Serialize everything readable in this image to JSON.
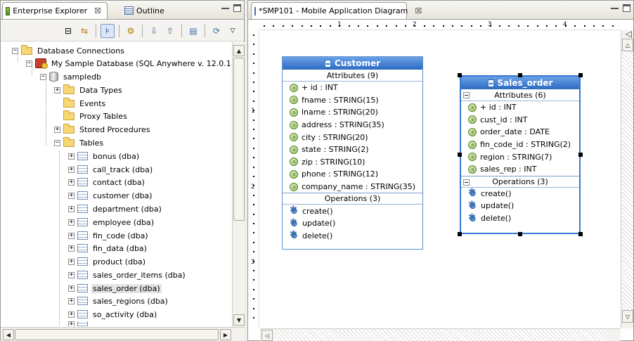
{
  "explorer": {
    "tabs": [
      {
        "label": "Enterprise Explorer",
        "close": "☒"
      },
      {
        "label": "Outline"
      }
    ],
    "tree": {
      "root": "Database Connections",
      "connection": "My Sample Database (SQL Anywhere v. 12.0.1",
      "database": "sampledb",
      "folders": [
        "Data Types",
        "Events",
        "Proxy Tables",
        "Stored Procedures",
        "Tables"
      ],
      "tables": [
        "bonus (dba)",
        "call_track (dba)",
        "contact (dba)",
        "customer (dba)",
        "department (dba)",
        "employee (dba)",
        "fin_code (dba)",
        "fin_data (dba)",
        "product (dba)",
        "sales_order_items (dba)",
        "sales_order (dba)",
        "sales_regions (dba)",
        "so_activity (dba)"
      ],
      "selected": "sales_order (dba)"
    }
  },
  "editor": {
    "tab_label": "*SMP101 - Mobile Application Diagram",
    "tab_close": "☒",
    "ruler_h": [
      "1",
      "2",
      "3",
      "4"
    ],
    "ruler_v": [
      "1",
      "2",
      "3"
    ]
  },
  "classes": [
    {
      "name": "Customer",
      "attributes_title": "Attributes (9)",
      "attributes": [
        "+ id : INT",
        "fname : STRING(15)",
        "lname : STRING(20)",
        "address : STRING(35)",
        "city : STRING(20)",
        "state : STRING(2)",
        "zip : STRING(10)",
        "phone : STRING(12)",
        "company_name : STRING(35)"
      ],
      "operations_title": "Operations (3)",
      "operations": [
        "create()",
        "update()",
        "delete()"
      ]
    },
    {
      "name": "Sales_order",
      "attributes_title": "Attributes (6)",
      "attributes": [
        "+ id : INT",
        "cust_id : INT",
        "order_date : DATE",
        "fin_code_id : STRING(2)",
        "region : STRING(7)",
        "sales_rep : INT"
      ],
      "operations_title": "Operations (3)",
      "operations": [
        "create()",
        "update()",
        "delete()"
      ]
    }
  ],
  "icons": {
    "explorer_tab": "enterprise-explorer-icon",
    "outline_tab": "outline-icon",
    "attribute": "attribute-icon",
    "operation": "operation-gear-icon"
  },
  "colors": {
    "class_header": "#2c6bc2",
    "selection": "#e4e4e4"
  }
}
